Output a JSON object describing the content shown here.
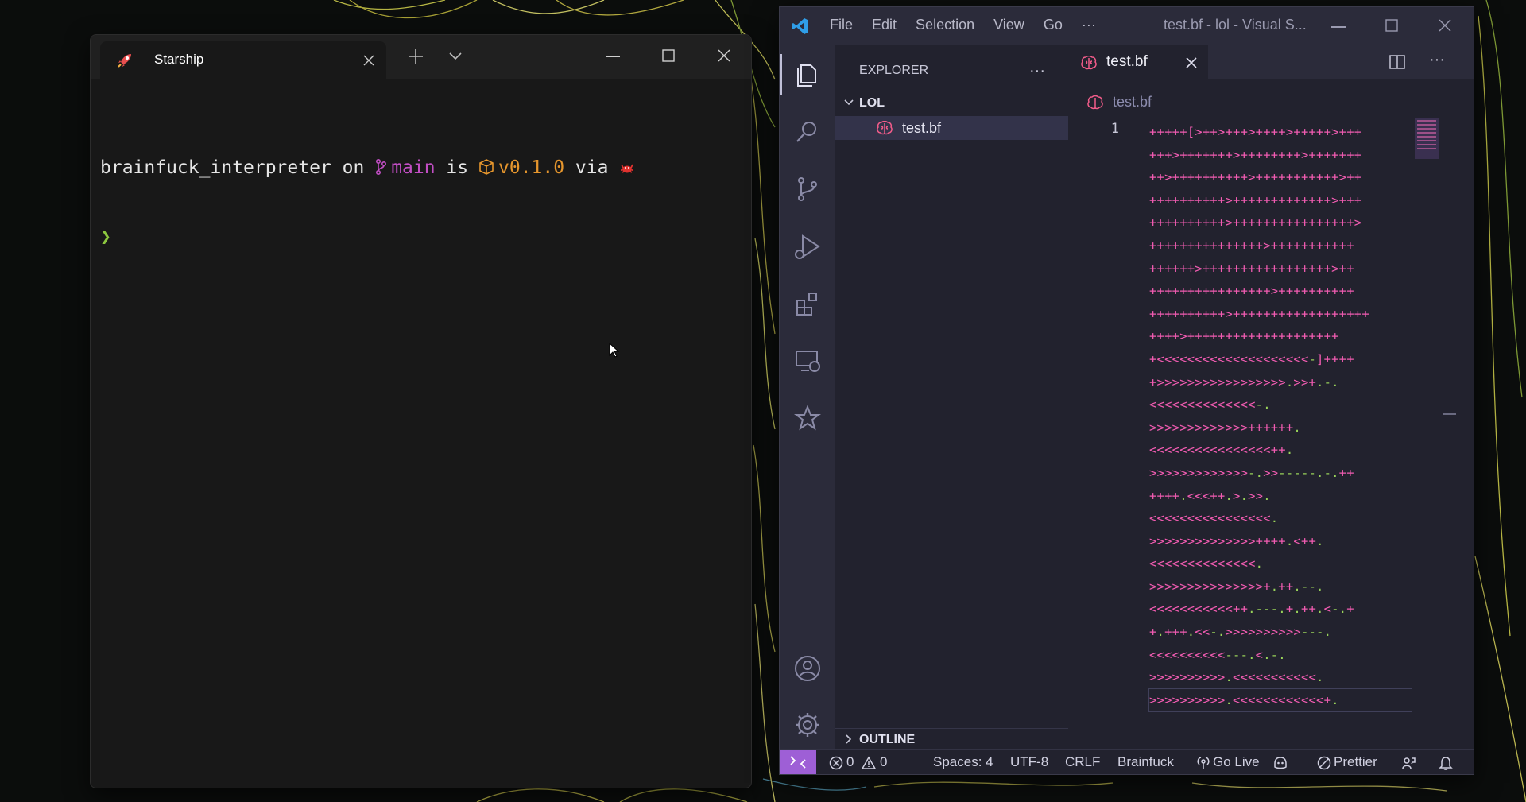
{
  "terminal": {
    "tab_title": "Starship",
    "prompt": {
      "dir": "brainfuck_interpreter",
      "on": " on ",
      "branch_icon": "",
      "branch": "main",
      "is": " is ",
      "package_icon": "📦",
      "version": "v0.1.0",
      "via": " via ",
      "lang_icon": "🦀",
      "char": "❯"
    }
  },
  "vscode": {
    "menu": [
      "File",
      "Edit",
      "Selection",
      "View",
      "Go",
      "···"
    ],
    "window_title": "test.bf - lol - Visual S...",
    "explorer": {
      "header": "EXPLORER",
      "more": "···",
      "folder": "LOL",
      "file": "test.bf",
      "outline": "OUTLINE"
    },
    "editor": {
      "tab": "test.bf",
      "breadcrumb": "test.bf",
      "more": "···",
      "line_number": "1",
      "code_lines": [
        "+++++[>++>+++>++++>+++++>+++",
        "+++>+++++++>++++++++>+++++++",
        "++>++++++++++>+++++++++++>++",
        "++++++++++>+++++++++++++>+++",
        "++++++++++>++++++++++++++++>",
        "+++++++++++++++>+++++++++++",
        "++++++>+++++++++++++++++>++",
        "++++++++++++++++>++++++++++",
        "++++++++++>++++++++++++++++++",
        "++++>++++++++++++++++++++",
        "+<<<<<<<<<<<<<<<<<<<<-]++++",
        "+>>>>>>>>>>>>>>>>>.>>+.-.",
        "<<<<<<<<<<<<<<-.",
        ">>>>>>>>>>>>>++++++.",
        "<<<<<<<<<<<<<<<<++.",
        ">>>>>>>>>>>>>-.>>-----.-.++",
        "++++.<<<++.>.>>.",
        "<<<<<<<<<<<<<<<<.",
        ">>>>>>>>>>>>>>++++.<++.",
        "<<<<<<<<<<<<<<.",
        ">>>>>>>>>>>>>>>+.++.--.",
        "<<<<<<<<<<<++.---.+.++.<-.+",
        "+.+++.<<-.>>>>>>>>>>---.",
        "<<<<<<<<<<---.<.-.",
        ">>>>>>>>>>.<<<<<<<<<<<.",
        ">>>>>>>>>>.<<<<<<<<<<<<+."
      ]
    },
    "status": {
      "errors": "0",
      "warnings": "0",
      "spaces": "Spaces: 4",
      "encoding": "UTF-8",
      "eol": "CRLF",
      "language": "Brainfuck",
      "golive": "Go Live",
      "prettier": "Prettier"
    },
    "colors": {
      "accent_remote": "#9e5fd6",
      "code_plus": "#f25cb2",
      "code_dot": "#9ad45a"
    }
  }
}
